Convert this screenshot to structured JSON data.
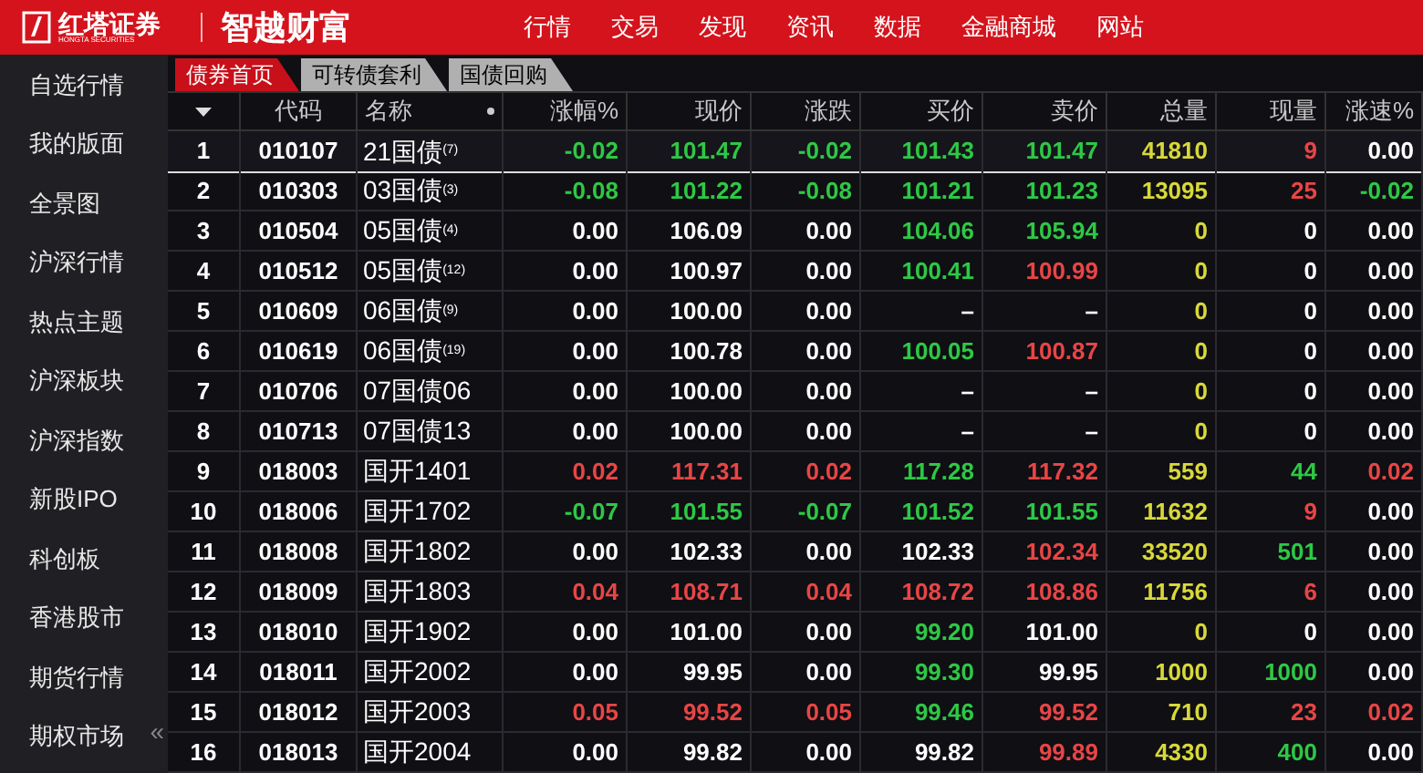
{
  "header": {
    "brand": "红塔证券",
    "brand_sub": "HONGTA SECURITIES",
    "product": "智越财富",
    "nav": [
      "行情",
      "交易",
      "发现",
      "资讯",
      "数据",
      "金融商城",
      "网站"
    ]
  },
  "sidebar": {
    "items": [
      {
        "label": "自选行情",
        "selected": false
      },
      {
        "label": "我的版面",
        "selected": false
      },
      {
        "label": "全景图",
        "selected": false
      },
      {
        "label": "沪深行情",
        "selected": false
      },
      {
        "label": "热点主题",
        "selected": false
      },
      {
        "label": "沪深板块",
        "selected": false
      },
      {
        "label": "沪深指数",
        "selected": false
      },
      {
        "label": "新股IPO",
        "selected": false
      },
      {
        "label": "科创板",
        "selected": false
      },
      {
        "label": "香港股市",
        "selected": false
      },
      {
        "label": "期货行情",
        "selected": false
      },
      {
        "label": "期权市场",
        "selected": false
      }
    ],
    "collapse": "«"
  },
  "tabs": [
    {
      "label": "债券首页",
      "selected": true
    },
    {
      "label": "可转债套利",
      "selected": false
    },
    {
      "label": "国债回购",
      "selected": false
    }
  ],
  "table": {
    "columns": [
      {
        "kind": "sort"
      },
      {
        "label": "代码",
        "kind": "text"
      },
      {
        "label": "名称",
        "kind": "name"
      },
      {
        "label": "涨幅%",
        "kind": "num"
      },
      {
        "label": "现价",
        "kind": "num"
      },
      {
        "label": "涨跌",
        "kind": "num"
      },
      {
        "label": "买价",
        "kind": "num"
      },
      {
        "label": "卖价",
        "kind": "num"
      },
      {
        "label": "总量",
        "kind": "num"
      },
      {
        "label": "现量",
        "kind": "num"
      },
      {
        "label": "涨速%",
        "kind": "num"
      }
    ],
    "rows": [
      {
        "selected": true,
        "cells": [
          {
            "text": "1",
            "color": "#ffffff"
          },
          {
            "text": "010107",
            "color": "#ffffff"
          },
          {
            "text": "21国债$^{(7)}$"
          },
          {
            "text": "-0.02",
            "color": "#2ec845"
          },
          {
            "text": "101.47",
            "color": "#2ec845"
          },
          {
            "text": "-0.02",
            "color": "#2ec845"
          },
          {
            "text": "101.43",
            "color": "#2ec845"
          },
          {
            "text": "101.47",
            "color": "#2ec845"
          },
          {
            "text": "41810",
            "color": "#d8d83a"
          },
          {
            "text": "9",
            "color": "#e84545"
          },
          {
            "text": "0.00",
            "color": "#ffffff"
          }
        ]
      },
      {
        "selected": false,
        "cells": [
          {
            "text": "2",
            "color": "#ffffff"
          },
          {
            "text": "010303",
            "color": "#ffffff"
          },
          {
            "text": "03国债$^{(3)}$"
          },
          {
            "text": "-0.08",
            "color": "#2ec845"
          },
          {
            "text": "101.22",
            "color": "#2ec845"
          },
          {
            "text": "-0.08",
            "color": "#2ec845"
          },
          {
            "text": "101.21",
            "color": "#2ec845"
          },
          {
            "text": "101.23",
            "color": "#2ec845"
          },
          {
            "text": "13095",
            "color": "#d8d83a"
          },
          {
            "text": "25",
            "color": "#e84545"
          },
          {
            "text": "-0.02",
            "color": "#2ec845"
          }
        ]
      },
      {
        "selected": false,
        "cells": [
          {
            "text": "3",
            "color": "#ffffff"
          },
          {
            "text": "010504",
            "color": "#ffffff"
          },
          {
            "text": "05国债$^{(4)}$"
          },
          {
            "text": "0.00",
            "color": "#ffffff"
          },
          {
            "text": "106.09",
            "color": "#ffffff"
          },
          {
            "text": "0.00",
            "color": "#ffffff"
          },
          {
            "text": "104.06",
            "color": "#2ec845"
          },
          {
            "text": "105.94",
            "color": "#2ec845"
          },
          {
            "text": "0",
            "color": "#d8d83a"
          },
          {
            "text": "0",
            "color": "#ffffff"
          },
          {
            "text": "0.00",
            "color": "#ffffff"
          }
        ]
      },
      {
        "selected": false,
        "cells": [
          {
            "text": "4",
            "color": "#ffffff"
          },
          {
            "text": "010512",
            "color": "#ffffff"
          },
          {
            "text": "05国债$^{(12)}$"
          },
          {
            "text": "0.00",
            "color": "#ffffff"
          },
          {
            "text": "100.97",
            "color": "#ffffff"
          },
          {
            "text": "0.00",
            "color": "#ffffff"
          },
          {
            "text": "100.41",
            "color": "#2ec845"
          },
          {
            "text": "100.99",
            "color": "#e84545"
          },
          {
            "text": "0",
            "color": "#d8d83a"
          },
          {
            "text": "0",
            "color": "#ffffff"
          },
          {
            "text": "0.00",
            "color": "#ffffff"
          }
        ]
      },
      {
        "selected": false,
        "cells": [
          {
            "text": "5",
            "color": "#ffffff"
          },
          {
            "text": "010609",
            "color": "#ffffff"
          },
          {
            "text": "06国债$^{(9)}$"
          },
          {
            "text": "0.00",
            "color": "#ffffff"
          },
          {
            "text": "100.00",
            "color": "#ffffff"
          },
          {
            "text": "0.00",
            "color": "#ffffff"
          },
          {
            "text": "–",
            "color": "#ffffff"
          },
          {
            "text": "–",
            "color": "#ffffff"
          },
          {
            "text": "0",
            "color": "#d8d83a"
          },
          {
            "text": "0",
            "color": "#ffffff"
          },
          {
            "text": "0.00",
            "color": "#ffffff"
          }
        ]
      },
      {
        "selected": false,
        "cells": [
          {
            "text": "6",
            "color": "#ffffff"
          },
          {
            "text": "010619",
            "color": "#ffffff"
          },
          {
            "text": "06国债$^{(19)}$"
          },
          {
            "text": "0.00",
            "color": "#ffffff"
          },
          {
            "text": "100.78",
            "color": "#ffffff"
          },
          {
            "text": "0.00",
            "color": "#ffffff"
          },
          {
            "text": "100.05",
            "color": "#2ec845"
          },
          {
            "text": "100.87",
            "color": "#e84545"
          },
          {
            "text": "0",
            "color": "#d8d83a"
          },
          {
            "text": "0",
            "color": "#ffffff"
          },
          {
            "text": "0.00",
            "color": "#ffffff"
          }
        ]
      },
      {
        "selected": false,
        "cells": [
          {
            "text": "7",
            "color": "#ffffff"
          },
          {
            "text": "010706",
            "color": "#ffffff"
          },
          {
            "text": "07国债06"
          },
          {
            "text": "0.00",
            "color": "#ffffff"
          },
          {
            "text": "100.00",
            "color": "#ffffff"
          },
          {
            "text": "0.00",
            "color": "#ffffff"
          },
          {
            "text": "–",
            "color": "#ffffff"
          },
          {
            "text": "–",
            "color": "#ffffff"
          },
          {
            "text": "0",
            "color": "#d8d83a"
          },
          {
            "text": "0",
            "color": "#ffffff"
          },
          {
            "text": "0.00",
            "color": "#ffffff"
          }
        ]
      },
      {
        "selected": false,
        "cells": [
          {
            "text": "8",
            "color": "#ffffff"
          },
          {
            "text": "010713",
            "color": "#ffffff"
          },
          {
            "text": "07国债13"
          },
          {
            "text": "0.00",
            "color": "#ffffff"
          },
          {
            "text": "100.00",
            "color": "#ffffff"
          },
          {
            "text": "0.00",
            "color": "#ffffff"
          },
          {
            "text": "–",
            "color": "#ffffff"
          },
          {
            "text": "–",
            "color": "#ffffff"
          },
          {
            "text": "0",
            "color": "#d8d83a"
          },
          {
            "text": "0",
            "color": "#ffffff"
          },
          {
            "text": "0.00",
            "color": "#ffffff"
          }
        ]
      },
      {
        "selected": false,
        "cells": [
          {
            "text": "9",
            "color": "#ffffff"
          },
          {
            "text": "018003",
            "color": "#ffffff"
          },
          {
            "text": "国开1401"
          },
          {
            "text": "0.02",
            "color": "#e84545"
          },
          {
            "text": "117.31",
            "color": "#e84545"
          },
          {
            "text": "0.02",
            "color": "#e84545"
          },
          {
            "text": "117.28",
            "color": "#2ec845"
          },
          {
            "text": "117.32",
            "color": "#e84545"
          },
          {
            "text": "559",
            "color": "#d8d83a"
          },
          {
            "text": "44",
            "color": "#2ec845"
          },
          {
            "text": "0.02",
            "color": "#e84545"
          }
        ]
      },
      {
        "selected": false,
        "cells": [
          {
            "text": "10",
            "color": "#ffffff"
          },
          {
            "text": "018006",
            "color": "#ffffff"
          },
          {
            "text": "国开1702"
          },
          {
            "text": "-0.07",
            "color": "#2ec845"
          },
          {
            "text": "101.55",
            "color": "#2ec845"
          },
          {
            "text": "-0.07",
            "color": "#2ec845"
          },
          {
            "text": "101.52",
            "color": "#2ec845"
          },
          {
            "text": "101.55",
            "color": "#2ec845"
          },
          {
            "text": "11632",
            "color": "#d8d83a"
          },
          {
            "text": "9",
            "color": "#e84545"
          },
          {
            "text": "0.00",
            "color": "#ffffff"
          }
        ]
      },
      {
        "selected": false,
        "cells": [
          {
            "text": "11",
            "color": "#ffffff"
          },
          {
            "text": "018008",
            "color": "#ffffff"
          },
          {
            "text": "国开1802"
          },
          {
            "text": "0.00",
            "color": "#ffffff"
          },
          {
            "text": "102.33",
            "color": "#ffffff"
          },
          {
            "text": "0.00",
            "color": "#ffffff"
          },
          {
            "text": "102.33",
            "color": "#ffffff"
          },
          {
            "text": "102.34",
            "color": "#e84545"
          },
          {
            "text": "33520",
            "color": "#d8d83a"
          },
          {
            "text": "501",
            "color": "#2ec845"
          },
          {
            "text": "0.00",
            "color": "#ffffff"
          }
        ]
      },
      {
        "selected": false,
        "cells": [
          {
            "text": "12",
            "color": "#ffffff"
          },
          {
            "text": "018009",
            "color": "#ffffff"
          },
          {
            "text": "国开1803"
          },
          {
            "text": "0.04",
            "color": "#e84545"
          },
          {
            "text": "108.71",
            "color": "#e84545"
          },
          {
            "text": "0.04",
            "color": "#e84545"
          },
          {
            "text": "108.72",
            "color": "#e84545"
          },
          {
            "text": "108.86",
            "color": "#e84545"
          },
          {
            "text": "11756",
            "color": "#d8d83a"
          },
          {
            "text": "6",
            "color": "#e84545"
          },
          {
            "text": "0.00",
            "color": "#ffffff"
          }
        ]
      },
      {
        "selected": false,
        "cells": [
          {
            "text": "13",
            "color": "#ffffff"
          },
          {
            "text": "018010",
            "color": "#ffffff"
          },
          {
            "text": "国开1902"
          },
          {
            "text": "0.00",
            "color": "#ffffff"
          },
          {
            "text": "101.00",
            "color": "#ffffff"
          },
          {
            "text": "0.00",
            "color": "#ffffff"
          },
          {
            "text": "99.20",
            "color": "#2ec845"
          },
          {
            "text": "101.00",
            "color": "#ffffff"
          },
          {
            "text": "0",
            "color": "#d8d83a"
          },
          {
            "text": "0",
            "color": "#ffffff"
          },
          {
            "text": "0.00",
            "color": "#ffffff"
          }
        ]
      },
      {
        "selected": false,
        "cells": [
          {
            "text": "14",
            "color": "#ffffff"
          },
          {
            "text": "018011",
            "color": "#ffffff"
          },
          {
            "text": "国开2002"
          },
          {
            "text": "0.00",
            "color": "#ffffff"
          },
          {
            "text": "99.95",
            "color": "#ffffff"
          },
          {
            "text": "0.00",
            "color": "#ffffff"
          },
          {
            "text": "99.30",
            "color": "#2ec845"
          },
          {
            "text": "99.95",
            "color": "#ffffff"
          },
          {
            "text": "1000",
            "color": "#d8d83a"
          },
          {
            "text": "1000",
            "color": "#2ec845"
          },
          {
            "text": "0.00",
            "color": "#ffffff"
          }
        ]
      },
      {
        "selected": false,
        "cells": [
          {
            "text": "15",
            "color": "#ffffff"
          },
          {
            "text": "018012",
            "color": "#ffffff"
          },
          {
            "text": "国开2003"
          },
          {
            "text": "0.05",
            "color": "#e84545"
          },
          {
            "text": "99.52",
            "color": "#e84545"
          },
          {
            "text": "0.05",
            "color": "#e84545"
          },
          {
            "text": "99.46",
            "color": "#2ec845"
          },
          {
            "text": "99.52",
            "color": "#e84545"
          },
          {
            "text": "710",
            "color": "#d8d83a"
          },
          {
            "text": "23",
            "color": "#e84545"
          },
          {
            "text": "0.02",
            "color": "#e84545"
          }
        ]
      },
      {
        "selected": false,
        "cells": [
          {
            "text": "16",
            "color": "#ffffff"
          },
          {
            "text": "018013",
            "color": "#ffffff"
          },
          {
            "text": "国开2004"
          },
          {
            "text": "0.00",
            "color": "#ffffff"
          },
          {
            "text": "99.82",
            "color": "#ffffff"
          },
          {
            "text": "0.00",
            "color": "#ffffff"
          },
          {
            "text": "99.82",
            "color": "#ffffff"
          },
          {
            "text": "99.89",
            "color": "#e84545"
          },
          {
            "text": "4330",
            "color": "#d8d83a"
          },
          {
            "text": "400",
            "color": "#2ec845"
          },
          {
            "text": "0.00",
            "color": "#ffffff"
          }
        ]
      }
    ]
  }
}
